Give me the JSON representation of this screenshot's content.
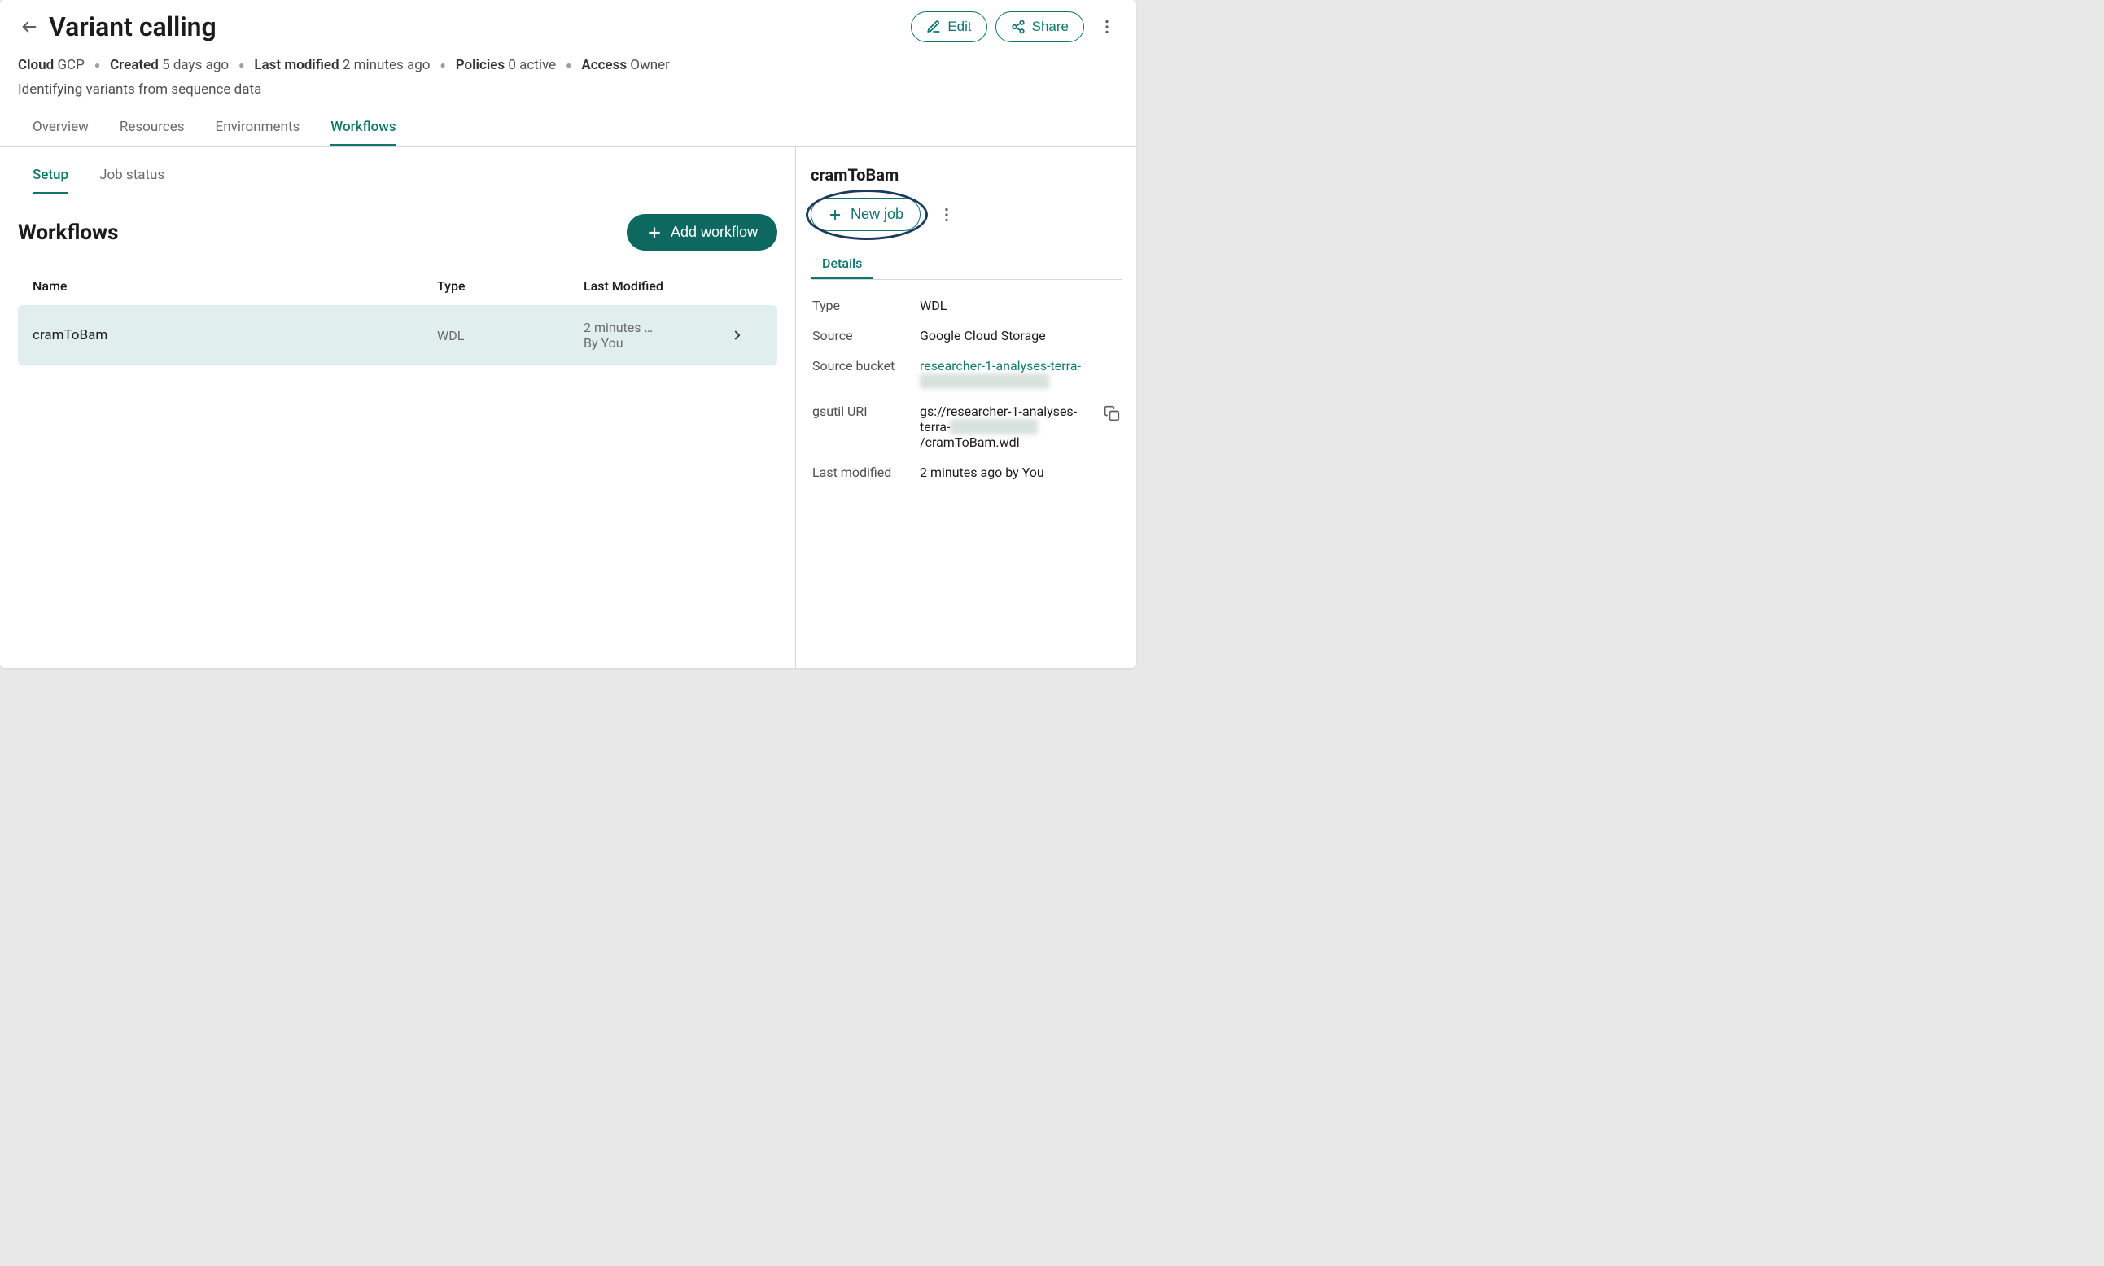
{
  "header": {
    "title": "Variant calling",
    "edit_label": "Edit",
    "share_label": "Share"
  },
  "meta": {
    "cloud_label": "Cloud",
    "cloud_value": "GCP",
    "created_label": "Created",
    "created_value": "5 days ago",
    "modified_label": "Last modified",
    "modified_value": "2 minutes ago",
    "policies_label": "Policies",
    "policies_value": "0 active",
    "access_label": "Access",
    "access_value": "Owner"
  },
  "description": "Identifying variants from sequence data",
  "tabs": {
    "overview": "Overview",
    "resources": "Resources",
    "environments": "Environments",
    "workflows": "Workflows"
  },
  "subtabs": {
    "setup": "Setup",
    "job_status": "Job status"
  },
  "workflows": {
    "heading": "Workflows",
    "add_label": "Add workflow",
    "columns": {
      "name": "Name",
      "type": "Type",
      "modified": "Last Modified"
    },
    "rows": [
      {
        "name": "cramToBam",
        "type": "WDL",
        "modified_time": "2 minutes …",
        "modified_by": "By You"
      }
    ]
  },
  "detail": {
    "title": "cramToBam",
    "new_job_label": "New job",
    "tab_details": "Details",
    "kv": {
      "type_label": "Type",
      "type_value": "WDL",
      "source_label": "Source",
      "source_value": "Google Cloud Storage",
      "bucket_label": "Source bucket",
      "bucket_link_prefix": "researcher-1-analyses-terra-",
      "uri_label": "gsutil URI",
      "uri_prefix": "gs://researcher-1-analyses-terra-",
      "uri_suffix": "/cramToBam.wdl",
      "last_mod_label": "Last modified",
      "last_mod_value": "2 minutes ago by You"
    }
  }
}
